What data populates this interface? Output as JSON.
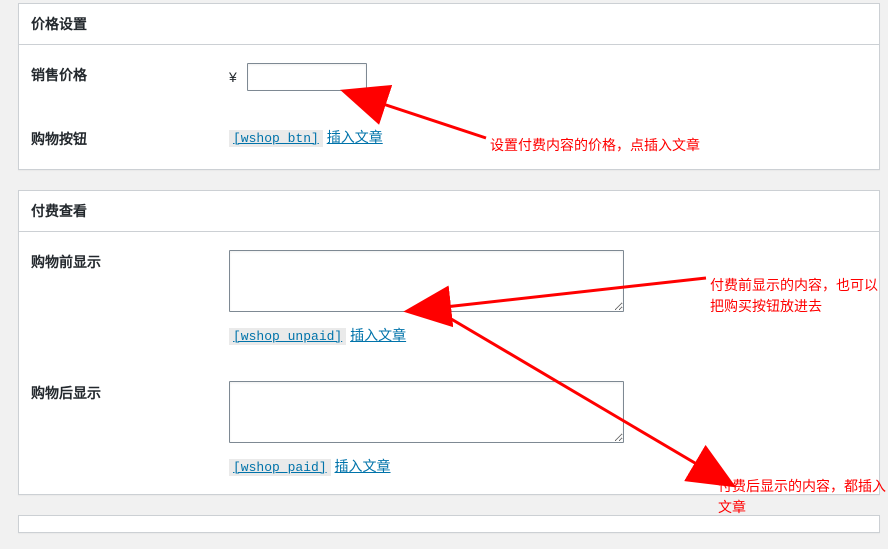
{
  "section1": {
    "title": "价格设置",
    "row_price": {
      "label": "销售价格",
      "currency": "¥",
      "value": ""
    },
    "row_button": {
      "label": "购物按钮",
      "shortcode": "[wshop_btn]",
      "insert_link": "插入文章"
    },
    "annotation": "设置付费内容的价格，点插入文章"
  },
  "section2": {
    "title": "付费查看",
    "row_before": {
      "label": "购物前显示",
      "value": "",
      "shortcode": "[wshop_unpaid]",
      "insert_link": "插入文章"
    },
    "row_after": {
      "label": "购物后显示",
      "value": "",
      "shortcode": "[wshop_paid]",
      "insert_link": "插入文章"
    },
    "annotation_before": "付费前显示的内容，也可以把购买按钮放进去",
    "annotation_after": "付费后显示的内容，都插入文章"
  }
}
